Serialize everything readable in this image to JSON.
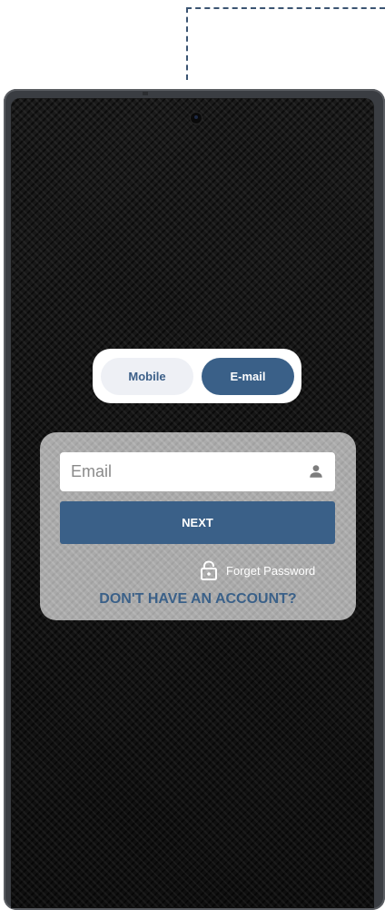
{
  "colors": {
    "accent": "#3a6088",
    "screen_background": "#141414",
    "card_background": "#cdcdcd",
    "connector": "#3b5472"
  },
  "login_method_toggle": {
    "options": [
      {
        "label": "Mobile",
        "selected": false
      },
      {
        "label": "E-mail",
        "selected": true
      }
    ]
  },
  "login_form": {
    "email_field": {
      "placeholder": "Email",
      "value": "",
      "icon": "person-icon"
    },
    "next_label": "NEXT",
    "forget_password": {
      "label": "Forget Password",
      "icon": "lock-icon"
    },
    "signup_label": "DON'T HAVE AN ACCOUNT?"
  }
}
